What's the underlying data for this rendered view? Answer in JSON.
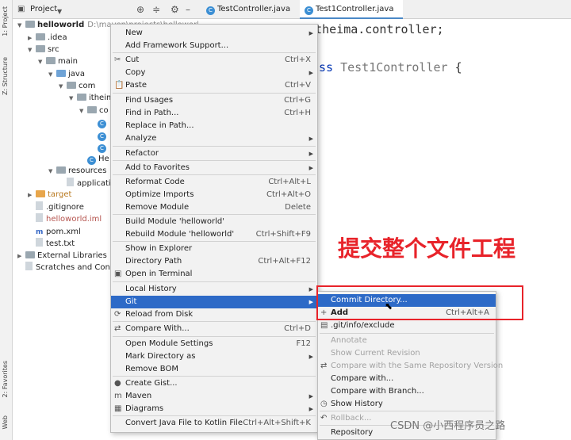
{
  "tool_strip": {
    "project_tab": "1: Project",
    "structure_tab": "Z: Structure",
    "favorites_tab": "2: Favorites",
    "web_tab": "Web"
  },
  "project_panel": {
    "title": "Project",
    "tree": [
      {
        "label": "helloworld",
        "suffix": "D:\\maven\\projects\\helloworld",
        "indent": 0,
        "icon": "folder",
        "arrow": "down",
        "bold": true
      },
      {
        "label": ".idea",
        "indent": 1,
        "icon": "folder",
        "arrow": "right"
      },
      {
        "label": "src",
        "indent": 1,
        "icon": "folder",
        "arrow": "down"
      },
      {
        "label": "main",
        "indent": 2,
        "icon": "folder",
        "arrow": "down"
      },
      {
        "label": "java",
        "indent": 3,
        "icon": "folder-blue",
        "arrow": "down"
      },
      {
        "label": "com",
        "indent": 4,
        "icon": "folder",
        "arrow": "down"
      },
      {
        "label": "itheim",
        "indent": 5,
        "icon": "folder",
        "arrow": "down"
      },
      {
        "label": "co",
        "indent": 6,
        "icon": "folder",
        "arrow": "down"
      },
      {
        "label": "",
        "indent": 7,
        "icon": "class",
        "arrow": ""
      },
      {
        "label": "",
        "indent": 7,
        "icon": "class",
        "arrow": ""
      },
      {
        "label": "",
        "indent": 7,
        "icon": "class",
        "arrow": ""
      },
      {
        "label": "He",
        "indent": 6,
        "icon": "class",
        "arrow": ""
      },
      {
        "label": "resources",
        "indent": 3,
        "icon": "folder",
        "arrow": "down"
      },
      {
        "label": "applicati",
        "indent": 4,
        "icon": "file",
        "arrow": ""
      },
      {
        "label": "target",
        "indent": 1,
        "icon": "folder-orange",
        "arrow": "right",
        "color": "#b8781e"
      },
      {
        "label": ".gitignore",
        "indent": 1,
        "icon": "file",
        "arrow": ""
      },
      {
        "label": "helloworld.iml",
        "indent": 1,
        "icon": "file",
        "arrow": "",
        "color": "#b5544e"
      },
      {
        "label": "pom.xml",
        "indent": 1,
        "icon": "maven",
        "arrow": ""
      },
      {
        "label": "test.txt",
        "indent": 1,
        "icon": "file",
        "arrow": ""
      },
      {
        "label": "External Libraries",
        "indent": 0,
        "icon": "lib",
        "arrow": "right"
      },
      {
        "label": "Scratches and Consol",
        "indent": 0,
        "icon": "scratch",
        "arrow": ""
      }
    ]
  },
  "editor": {
    "tabs": [
      {
        "label": "TestController.java",
        "active": false
      },
      {
        "label": "Test1Controller.java",
        "active": true
      }
    ],
    "code_line1": "m.itheima.controller;",
    "code_kw": "ss",
    "code_class": "Test1Controller",
    "code_brace": " {",
    "annotation": "提交整个文件工程",
    "watermark": "CSDN @小西程序员之路"
  },
  "context_menu": [
    {
      "label": "New",
      "shortcut": "",
      "submenu": true,
      "sep_before": false
    },
    {
      "label": "Add Framework Support...",
      "shortcut": "",
      "submenu": false
    },
    {
      "label": "Cut",
      "shortcut": "Ctrl+X",
      "icon": "✂",
      "sep_before": true
    },
    {
      "label": "Copy",
      "shortcut": "",
      "submenu": true
    },
    {
      "label": "Paste",
      "shortcut": "Ctrl+V",
      "icon": "📋"
    },
    {
      "label": "Find Usages",
      "shortcut": "Ctrl+G",
      "sep_before": true
    },
    {
      "label": "Find in Path...",
      "shortcut": "Ctrl+H"
    },
    {
      "label": "Replace in Path...",
      "shortcut": ""
    },
    {
      "label": "Analyze",
      "shortcut": "",
      "submenu": true
    },
    {
      "label": "Refactor",
      "shortcut": "",
      "submenu": true,
      "sep_before": true
    },
    {
      "label": "Add to Favorites",
      "shortcut": "",
      "submenu": true,
      "sep_before": true
    },
    {
      "label": "Reformat Code",
      "shortcut": "Ctrl+Alt+L",
      "sep_before": true
    },
    {
      "label": "Optimize Imports",
      "shortcut": "Ctrl+Alt+O"
    },
    {
      "label": "Remove Module",
      "shortcut": "Delete"
    },
    {
      "label": "Build Module 'helloworld'",
      "shortcut": "",
      "sep_before": true
    },
    {
      "label": "Rebuild Module 'helloworld'",
      "shortcut": "Ctrl+Shift+F9"
    },
    {
      "label": "Show in Explorer",
      "shortcut": "",
      "sep_before": true
    },
    {
      "label": "Directory Path",
      "shortcut": "Ctrl+Alt+F12"
    },
    {
      "label": "Open in Terminal",
      "shortcut": "",
      "icon": "▣"
    },
    {
      "label": "Local History",
      "shortcut": "",
      "submenu": true,
      "sep_before": true
    },
    {
      "label": "Git",
      "shortcut": "",
      "submenu": true,
      "selected": true
    },
    {
      "label": "Reload from Disk",
      "shortcut": "",
      "icon": "⟳"
    },
    {
      "label": "Compare With...",
      "shortcut": "Ctrl+D",
      "icon": "⇄",
      "sep_before": true
    },
    {
      "label": "Open Module Settings",
      "shortcut": "F12",
      "sep_before": true
    },
    {
      "label": "Mark Directory as",
      "shortcut": "",
      "submenu": true
    },
    {
      "label": "Remove BOM",
      "shortcut": ""
    },
    {
      "label": "Create Gist...",
      "shortcut": "",
      "icon": "●",
      "sep_before": true
    },
    {
      "label": "Maven",
      "shortcut": "",
      "submenu": true,
      "icon": "m"
    },
    {
      "label": "Diagrams",
      "shortcut": "",
      "submenu": true,
      "icon": "▦"
    },
    {
      "label": "Convert Java File to Kotlin File",
      "shortcut": "Ctrl+Alt+Shift+K",
      "sep_before": true
    }
  ],
  "git_submenu": [
    {
      "label": "Commit Directory...",
      "shortcut": "",
      "selected": true
    },
    {
      "label": "Add",
      "shortcut": "Ctrl+Alt+A",
      "icon": "+"
    },
    {
      "label": ".git/info/exclude",
      "shortcut": "",
      "icon": "▤"
    },
    {
      "label": "Annotate",
      "shortcut": "",
      "disabled": true,
      "sep_before": true
    },
    {
      "label": "Show Current Revision",
      "shortcut": "",
      "disabled": true
    },
    {
      "label": "Compare with the Same Repository Version",
      "shortcut": "",
      "disabled": true,
      "icon": "⇄"
    },
    {
      "label": "Compare with...",
      "shortcut": ""
    },
    {
      "label": "Compare with Branch...",
      "shortcut": ""
    },
    {
      "label": "Show History",
      "shortcut": "",
      "icon": "◷"
    },
    {
      "label": "Rollback...",
      "shortcut": "",
      "disabled": true,
      "icon": "↶",
      "sep_before": true
    },
    {
      "label": "Repository",
      "shortcut": "",
      "sep_before": true
    }
  ]
}
